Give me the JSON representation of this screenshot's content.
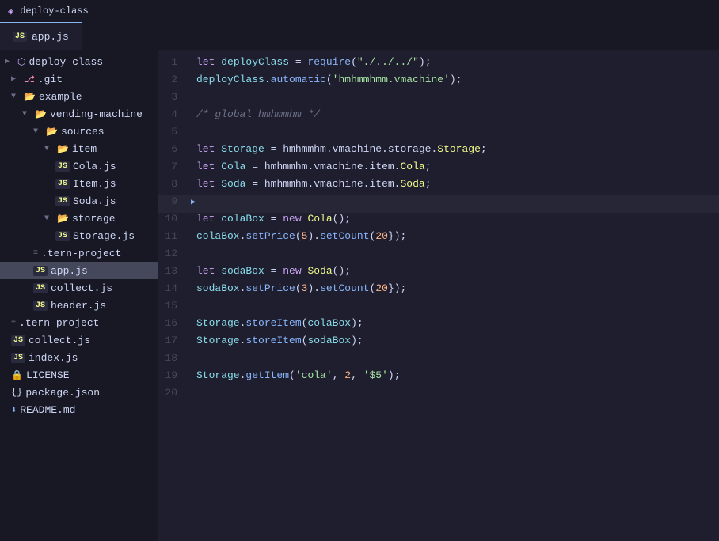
{
  "titlebar": {
    "title": "deploy-class",
    "icon": "◈"
  },
  "tabs": [
    {
      "label": "app.js",
      "icon": "JS",
      "active": true
    }
  ],
  "sidebar": {
    "sections": [
      {
        "id": "deploy-class",
        "label": "deploy-class",
        "indent": "root",
        "type": "root-folder",
        "expanded": true
      }
    ],
    "tree": [
      {
        "id": "git",
        "label": ".git",
        "indent": 1,
        "type": "git",
        "icon": "⎇"
      },
      {
        "id": "example",
        "label": "example",
        "indent": 1,
        "type": "folder",
        "expanded": true
      },
      {
        "id": "vending-machine",
        "label": "vending-machine",
        "indent": 2,
        "type": "folder",
        "expanded": true
      },
      {
        "id": "sources",
        "label": "sources",
        "indent": 3,
        "type": "folder",
        "expanded": true
      },
      {
        "id": "item",
        "label": "item",
        "indent": 4,
        "type": "folder",
        "expanded": true
      },
      {
        "id": "Cola.js",
        "label": "Cola.js",
        "indent": 5,
        "type": "js-file"
      },
      {
        "id": "Item.js",
        "label": "Item.js",
        "indent": 5,
        "type": "js-file"
      },
      {
        "id": "Soda.js",
        "label": "Soda.js",
        "indent": 5,
        "type": "js-file"
      },
      {
        "id": "storage",
        "label": "storage",
        "indent": 4,
        "type": "folder",
        "expanded": true
      },
      {
        "id": "Storage.js",
        "label": "Storage.js",
        "indent": 5,
        "type": "js-file"
      },
      {
        "id": ".tern-project-1",
        "label": ".tern-project",
        "indent": 3,
        "type": "menu-dots"
      },
      {
        "id": "app.js",
        "label": "app.js",
        "indent": 3,
        "type": "js-file",
        "active": true
      },
      {
        "id": "collect.js-1",
        "label": "collect.js",
        "indent": 3,
        "type": "js-file"
      },
      {
        "id": "header.js",
        "label": "header.js",
        "indent": 3,
        "type": "js-file"
      },
      {
        "id": ".tern-project-2",
        "label": ".tern-project",
        "indent": 1,
        "type": "menu-dots"
      },
      {
        "id": "collect.js-2",
        "label": "collect.js",
        "indent": 1,
        "type": "js-file"
      },
      {
        "id": "index.js",
        "label": "index.js",
        "indent": 1,
        "type": "js-file"
      },
      {
        "id": "LICENSE",
        "label": "LICENSE",
        "indent": 1,
        "type": "license"
      },
      {
        "id": "package.json",
        "label": "package.json",
        "indent": 1,
        "type": "package"
      },
      {
        "id": "README.md",
        "label": "README.md",
        "indent": 1,
        "type": "readme"
      }
    ]
  },
  "code": {
    "lines": [
      {
        "num": 1,
        "tokens": [
          {
            "t": "kw",
            "v": "let "
          },
          {
            "t": "var-name",
            "v": "deployClass"
          },
          {
            "t": "punct",
            "v": " = "
          },
          {
            "t": "require-fn",
            "v": "require"
          },
          {
            "t": "punct",
            "v": "("
          },
          {
            "t": "path",
            "v": "\"./../../\""
          },
          {
            "t": "punct",
            "v": ");"
          }
        ]
      },
      {
        "num": 2,
        "tokens": [
          {
            "t": "var-name",
            "v": "deployClass"
          },
          {
            "t": "punct",
            "v": "."
          },
          {
            "t": "method",
            "v": "automatic"
          },
          {
            "t": "punct",
            "v": "("
          },
          {
            "t": "path",
            "v": "'hmhmmhmm.vmachine'"
          },
          {
            "t": "punct",
            "v": ");"
          }
        ]
      },
      {
        "num": 3,
        "tokens": []
      },
      {
        "num": 4,
        "tokens": [
          {
            "t": "comment",
            "v": "/* global hmhmmhm */"
          }
        ]
      },
      {
        "num": 5,
        "tokens": []
      },
      {
        "num": 6,
        "tokens": [
          {
            "t": "kw",
            "v": "let "
          },
          {
            "t": "var-name",
            "v": "Storage"
          },
          {
            "t": "punct",
            "v": " = "
          },
          {
            "t": "prop",
            "v": "hmhmmhm.vmachine.storage."
          },
          {
            "t": "class-name",
            "v": "Storage"
          },
          {
            "t": "punct",
            "v": ";"
          }
        ]
      },
      {
        "num": 7,
        "tokens": [
          {
            "t": "kw",
            "v": "let "
          },
          {
            "t": "var-name",
            "v": "Cola"
          },
          {
            "t": "punct",
            "v": " = "
          },
          {
            "t": "prop",
            "v": "hmhmmhm.vmachine.item."
          },
          {
            "t": "class-name",
            "v": "Cola"
          },
          {
            "t": "punct",
            "v": ";"
          }
        ]
      },
      {
        "num": 8,
        "tokens": [
          {
            "t": "kw",
            "v": "let "
          },
          {
            "t": "var-name",
            "v": "Soda"
          },
          {
            "t": "punct",
            "v": " = "
          },
          {
            "t": "prop",
            "v": "hmhmmhm.vmachine.item."
          },
          {
            "t": "class-name",
            "v": "Soda"
          },
          {
            "t": "punct",
            "v": ";"
          }
        ]
      },
      {
        "num": 9,
        "tokens": [],
        "highlighted": true
      },
      {
        "num": 10,
        "tokens": [
          {
            "t": "kw",
            "v": "let "
          },
          {
            "t": "var-name",
            "v": "colaBox"
          },
          {
            "t": "punct",
            "v": " = "
          },
          {
            "t": "kw",
            "v": "new "
          },
          {
            "t": "class-name",
            "v": "Cola"
          },
          {
            "t": "punct",
            "v": "();"
          }
        ]
      },
      {
        "num": 11,
        "tokens": [
          {
            "t": "var-name",
            "v": "colaBox"
          },
          {
            "t": "punct",
            "v": "."
          },
          {
            "t": "method",
            "v": "setPrice"
          },
          {
            "t": "punct",
            "v": "("
          },
          {
            "t": "num",
            "v": "5"
          },
          {
            "t": "punct",
            "v": ")"
          },
          {
            "t": "punct",
            "v": "."
          },
          {
            "t": "method",
            "v": "setCount"
          },
          {
            "t": "punct",
            "v": "("
          },
          {
            "t": "num",
            "v": "20"
          },
          {
            "t": "punct",
            "v": "});"
          }
        ]
      },
      {
        "num": 12,
        "tokens": []
      },
      {
        "num": 13,
        "tokens": [
          {
            "t": "kw",
            "v": "let "
          },
          {
            "t": "var-name",
            "v": "sodaBox"
          },
          {
            "t": "punct",
            "v": " = "
          },
          {
            "t": "kw",
            "v": "new "
          },
          {
            "t": "class-name",
            "v": "Soda"
          },
          {
            "t": "punct",
            "v": "();"
          }
        ]
      },
      {
        "num": 14,
        "tokens": [
          {
            "t": "var-name",
            "v": "sodaBox"
          },
          {
            "t": "punct",
            "v": "."
          },
          {
            "t": "method",
            "v": "setPrice"
          },
          {
            "t": "punct",
            "v": "("
          },
          {
            "t": "num",
            "v": "3"
          },
          {
            "t": "punct",
            "v": ")"
          },
          {
            "t": "punct",
            "v": "."
          },
          {
            "t": "method",
            "v": "setCount"
          },
          {
            "t": "punct",
            "v": "("
          },
          {
            "t": "num",
            "v": "20"
          },
          {
            "t": "punct",
            "v": "});"
          }
        ]
      },
      {
        "num": 15,
        "tokens": []
      },
      {
        "num": 16,
        "tokens": [
          {
            "t": "var-name",
            "v": "Storage"
          },
          {
            "t": "punct",
            "v": "."
          },
          {
            "t": "method",
            "v": "storeItem"
          },
          {
            "t": "punct",
            "v": "("
          },
          {
            "t": "var-name",
            "v": "colaBox"
          },
          {
            "t": "punct",
            "v": ");"
          }
        ]
      },
      {
        "num": 17,
        "tokens": [
          {
            "t": "var-name",
            "v": "Storage"
          },
          {
            "t": "punct",
            "v": "."
          },
          {
            "t": "method",
            "v": "storeItem"
          },
          {
            "t": "punct",
            "v": "("
          },
          {
            "t": "var-name",
            "v": "sodaBox"
          },
          {
            "t": "punct",
            "v": ");"
          }
        ]
      },
      {
        "num": 18,
        "tokens": []
      },
      {
        "num": 19,
        "tokens": [
          {
            "t": "var-name",
            "v": "Storage"
          },
          {
            "t": "punct",
            "v": "."
          },
          {
            "t": "method",
            "v": "getItem"
          },
          {
            "t": "punct",
            "v": "("
          },
          {
            "t": "path",
            "v": "'cola'"
          },
          {
            "t": "punct",
            "v": ", "
          },
          {
            "t": "num",
            "v": "2"
          },
          {
            "t": "punct",
            "v": ", "
          },
          {
            "t": "path",
            "v": "'$5'"
          },
          {
            "t": "punct",
            "v": ");"
          }
        ]
      },
      {
        "num": 20,
        "tokens": []
      }
    ]
  }
}
